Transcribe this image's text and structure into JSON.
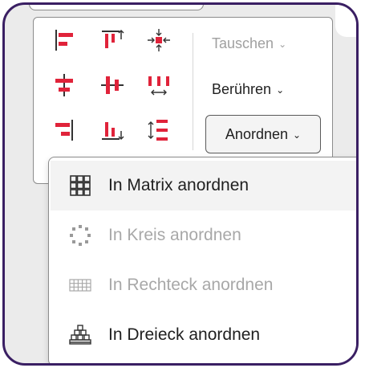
{
  "ribbon": {
    "align_icons": [
      {
        "name": "align-left-icon"
      },
      {
        "name": "align-top-icon"
      },
      {
        "name": "align-center-point-icon"
      },
      {
        "name": "align-center-horizontal-icon"
      },
      {
        "name": "align-middle-vertical-icon"
      },
      {
        "name": "distribute-horizontal-icon"
      },
      {
        "name": "align-right-icon"
      },
      {
        "name": "align-bottom-icon"
      },
      {
        "name": "distribute-vertical-icon"
      }
    ],
    "swap_label": "Tauschen",
    "touch_label": "Berühren",
    "arrange_label": "Anordnen",
    "chevron": "⌄"
  },
  "dropdown": {
    "items": [
      {
        "label": "In Matrix anordnen",
        "icon": "matrix-grid-icon",
        "enabled": true,
        "hovered": true
      },
      {
        "label": "In Kreis anordnen",
        "icon": "circle-dots-icon",
        "enabled": false
      },
      {
        "label": "In Rechteck anordnen",
        "icon": "rectangle-grid-icon",
        "enabled": false
      },
      {
        "label": "In Dreieck anordnen",
        "icon": "triangle-stack-icon",
        "enabled": true
      }
    ]
  },
  "colors": {
    "frame": "#3a1f63",
    "accent_red": "#e0233a",
    "text": "#1f1f1f",
    "disabled_text": "#a0a0a0"
  }
}
